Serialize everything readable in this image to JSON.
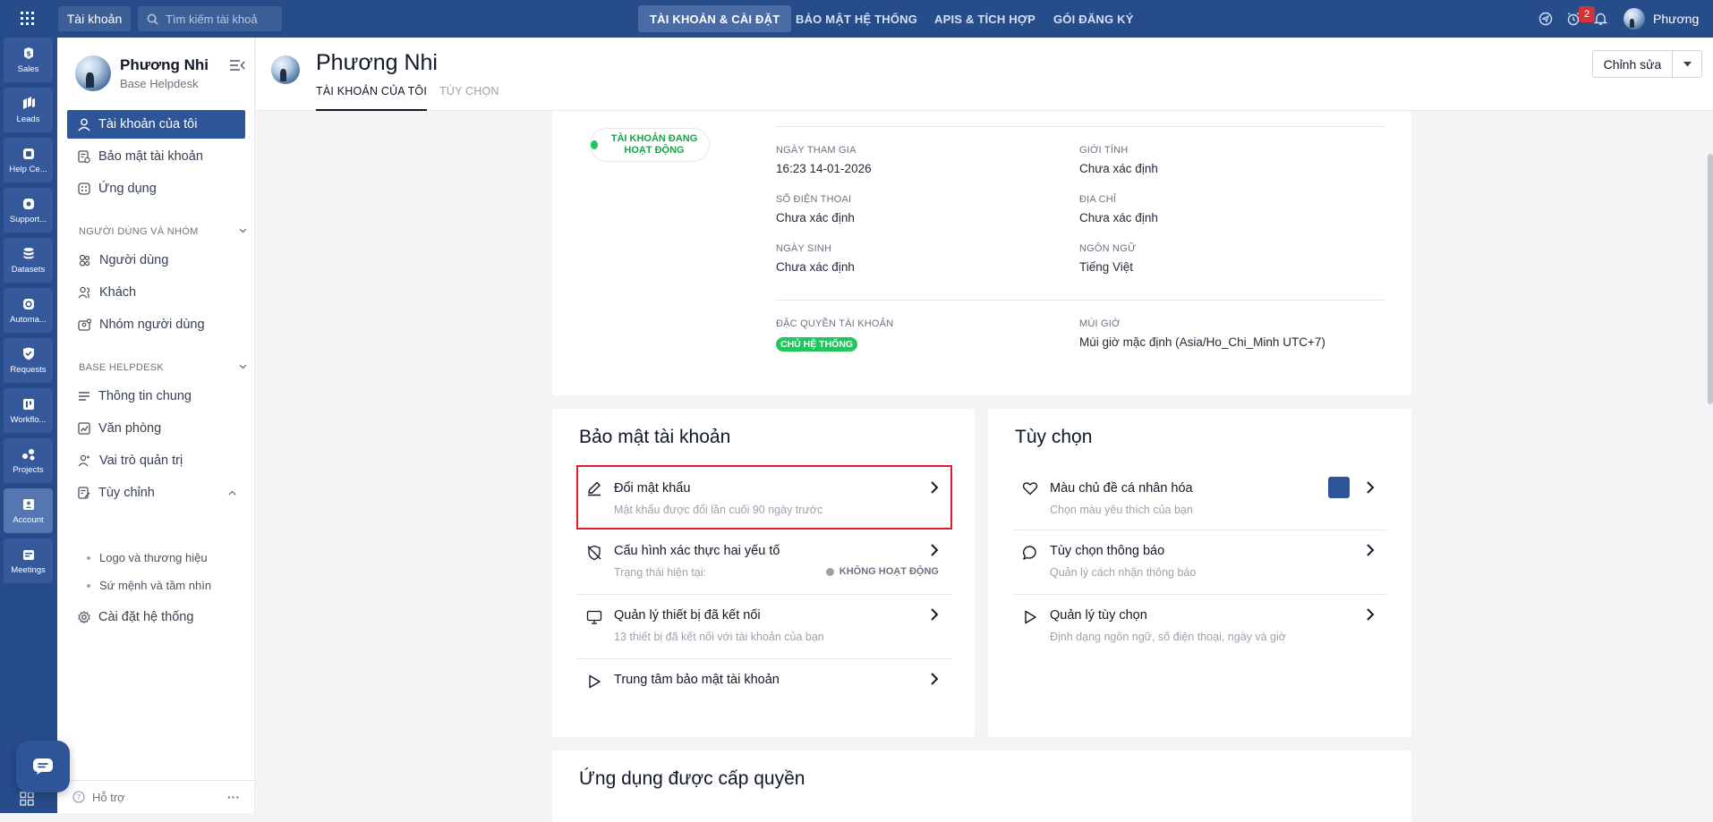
{
  "topbar": {
    "account_button": "Tài khoản",
    "search_placeholder": "Tìm kiếm tài khoả",
    "nav": [
      "TÀI KHOẢN & CÀI ĐẶT",
      "BẢO MẬT HỆ THỐNG",
      "APIS & TÍCH HỢP",
      "GÓI ĐĂNG KÝ"
    ],
    "active_nav": "TÀI KHOẢN & CÀI ĐẶT",
    "notification_count": "2",
    "user_name": "Phương"
  },
  "rail": [
    {
      "label": "Sales",
      "icon": "dollar-icon"
    },
    {
      "label": "Leads",
      "icon": "leads-icon"
    },
    {
      "label": "Help Ce...",
      "icon": "help-center-icon"
    },
    {
      "label": "Support...",
      "icon": "support-icon"
    },
    {
      "label": "Datasets",
      "icon": "database-icon"
    },
    {
      "label": "Automa...",
      "icon": "automation-icon"
    },
    {
      "label": "Requests",
      "icon": "shield-icon"
    },
    {
      "label": "Workflo...",
      "icon": "workflow-icon"
    },
    {
      "label": "Projects",
      "icon": "projects-icon"
    },
    {
      "label": "Account",
      "icon": "account-icon",
      "active": true
    },
    {
      "label": "Meetings",
      "icon": "meetings-icon"
    }
  ],
  "sidebar": {
    "user_name": "Phương Nhi",
    "user_sub": "Base Helpdesk",
    "items": [
      {
        "label": "Tài khoản của tôi",
        "active": true
      },
      {
        "label": "Bảo mật tài khoản"
      },
      {
        "label": "Ứng dụng"
      }
    ],
    "section_users": "NGƯỜI DÙNG VÀ NHÓM",
    "users_items": [
      {
        "label": "Người dùng"
      },
      {
        "label": "Khách"
      },
      {
        "label": "Nhóm người dùng"
      }
    ],
    "section_base": "BASE HELPDESK",
    "base_items": [
      {
        "label": "Thông tin chung"
      },
      {
        "label": "Văn phòng"
      },
      {
        "label": "Vai trò quản trị"
      },
      {
        "label": "Tùy chỉnh"
      }
    ],
    "custom_sub": [
      "Logo và thương hiệu",
      "Sứ mệnh và tầm nhìn"
    ],
    "system_settings": "Cài đặt hệ thống",
    "footer_support": "Hỗ trợ",
    "footer_more": "···"
  },
  "header": {
    "name": "Phương Nhi",
    "tabs": [
      "TÀI KHOẢN CỦA TÔI",
      "TÙY CHỌN"
    ],
    "active_tab": "TÀI KHOẢN CỦA TÔI",
    "edit_button": "Chỉnh sửa"
  },
  "profile": {
    "status": "TÀI KHOẢN ĐANG HOẠT ĐỘNG",
    "joined_label": "NGÀY THAM GIA",
    "joined_value": "16:23 14-01-2026",
    "gender_label": "GIỚI TÍNH",
    "gender_value": "Chưa xác định",
    "phone_label": "SỐ ĐIỆN THOẠI",
    "phone_value": "Chưa xác định",
    "address_label": "ĐỊA CHỈ",
    "address_value": "Chưa xác định",
    "dob_label": "NGÀY SINH",
    "dob_value": "Chưa xác định",
    "language_label": "NGÔN NGỮ",
    "language_value": "Tiếng Việt",
    "privilege_label": "ĐẶC QUYỀN TÀI KHOẢN",
    "privilege_value": "CHỦ HỆ THỐNG",
    "timezone_label": "MÚI GIỜ",
    "timezone_value": "Múi giờ mặc định (Asia/Ho_Chi_Minh UTC+7)"
  },
  "security": {
    "title": "Bảo mật tài khoản",
    "rows": [
      {
        "title": "Đổi mật khẩu",
        "desc": "Mật khẩu được đổi lần cuối 90 ngày trước",
        "icon": "pencil-icon"
      },
      {
        "title": "Cấu hình xác thực hai yếu tố",
        "desc": "Trạng thái hiện tại:",
        "status": "KHÔNG HOẠT ĐỘNG",
        "icon": "shield-off-icon"
      },
      {
        "title": "Quản lý thiết bị đã kết nối",
        "desc": "13 thiết bị đã kết nối với tài khoản của bạn",
        "icon": "monitor-icon"
      },
      {
        "title": "Trung tâm bảo mật tài khoản",
        "desc": "",
        "icon": "play-icon"
      }
    ]
  },
  "preferences": {
    "title": "Tùy chọn",
    "rows": [
      {
        "title": "Màu chủ đề cá nhân hóa",
        "desc": "Chọn màu yêu thích của bạn",
        "icon": "heart-icon",
        "swatch": "#2d5597"
      },
      {
        "title": "Tùy chọn thông báo",
        "desc": "Quản lý cách nhận thông báo",
        "icon": "chat-icon"
      },
      {
        "title": "Quản lý tùy chọn",
        "desc": "Định dạng ngôn ngữ, số điện thoại, ngày và giờ",
        "icon": "play-icon"
      }
    ]
  },
  "apps": {
    "title": "Ứng dụng được cấp quyền"
  },
  "colors": {
    "brand": "#274c8a",
    "accent": "#2d5597",
    "success": "#22c55e",
    "highlight": "#e11d2a"
  }
}
